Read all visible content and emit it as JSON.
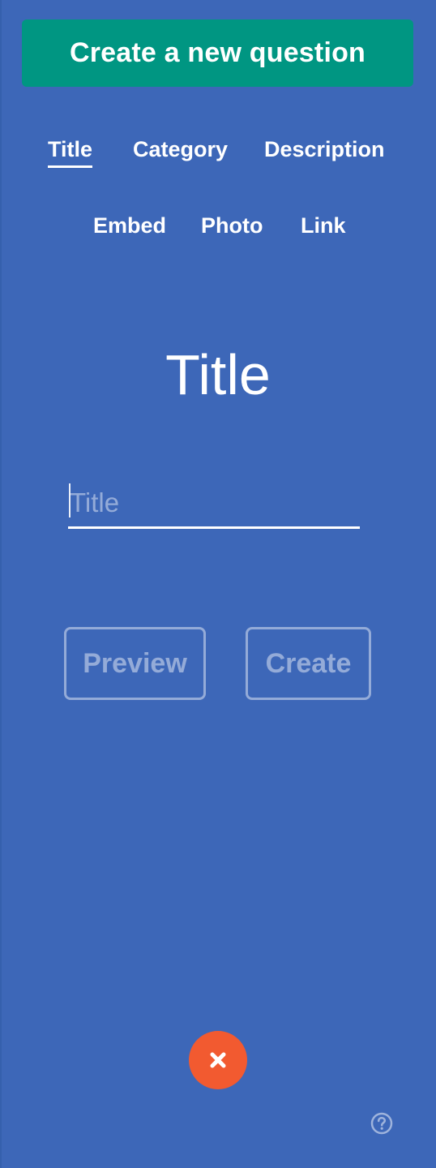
{
  "header": {
    "title": "Create a new question"
  },
  "tabs": [
    {
      "label": "Title",
      "active": true
    },
    {
      "label": "Category",
      "active": false
    },
    {
      "label": "Description",
      "active": false
    },
    {
      "label": "Embed",
      "active": false
    },
    {
      "label": "Photo",
      "active": false
    },
    {
      "label": "Link",
      "active": false
    }
  ],
  "section": {
    "heading": "Title"
  },
  "title_field": {
    "placeholder": "Title",
    "value": ""
  },
  "actions": {
    "preview_label": "Preview",
    "create_label": "Create"
  },
  "icons": {
    "close": "close-icon",
    "help": "help-icon"
  },
  "colors": {
    "background": "#3d67b8",
    "header_button": "#009682",
    "close_button": "#f25a30"
  }
}
